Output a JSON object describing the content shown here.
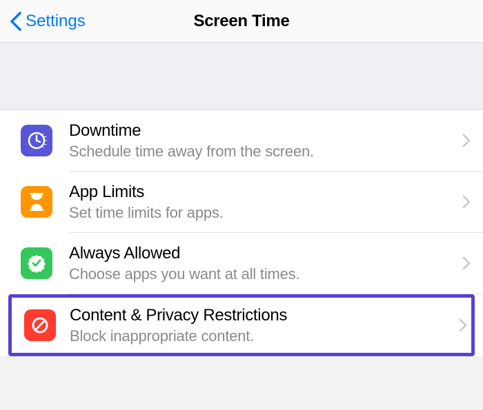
{
  "nav": {
    "back_label": "Settings",
    "title": "Screen Time"
  },
  "rows": {
    "downtime": {
      "title": "Downtime",
      "subtitle": "Schedule time away from the screen."
    },
    "app_limits": {
      "title": "App Limits",
      "subtitle": "Set time limits for apps."
    },
    "always_allowed": {
      "title": "Always Allowed",
      "subtitle": "Choose apps you want at all times."
    },
    "content_privacy": {
      "title": "Content & Privacy Restrictions",
      "subtitle": "Block inappropriate content."
    }
  }
}
